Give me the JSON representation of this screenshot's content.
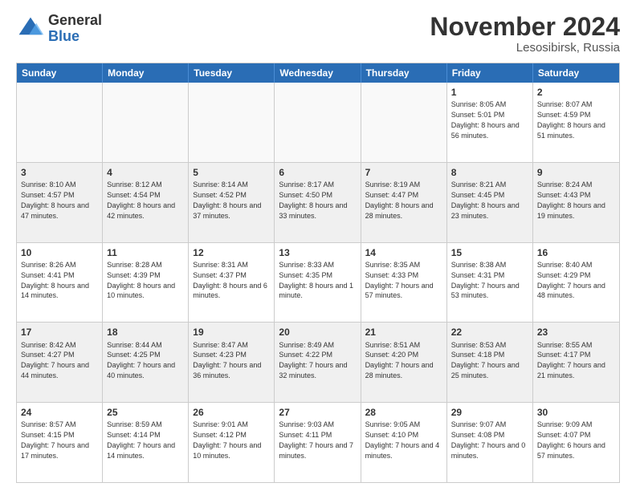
{
  "logo": {
    "general": "General",
    "blue": "Blue"
  },
  "header": {
    "month": "November 2024",
    "location": "Lesosibirsk, Russia"
  },
  "weekdays": [
    "Sunday",
    "Monday",
    "Tuesday",
    "Wednesday",
    "Thursday",
    "Friday",
    "Saturday"
  ],
  "rows": [
    [
      {
        "day": "",
        "info": "",
        "empty": true
      },
      {
        "day": "",
        "info": "",
        "empty": true
      },
      {
        "day": "",
        "info": "",
        "empty": true
      },
      {
        "day": "",
        "info": "",
        "empty": true
      },
      {
        "day": "",
        "info": "",
        "empty": true
      },
      {
        "day": "1",
        "info": "Sunrise: 8:05 AM\nSunset: 5:01 PM\nDaylight: 8 hours and 56 minutes.",
        "empty": false
      },
      {
        "day": "2",
        "info": "Sunrise: 8:07 AM\nSunset: 4:59 PM\nDaylight: 8 hours and 51 minutes.",
        "empty": false
      }
    ],
    [
      {
        "day": "3",
        "info": "Sunrise: 8:10 AM\nSunset: 4:57 PM\nDaylight: 8 hours and 47 minutes.",
        "empty": false
      },
      {
        "day": "4",
        "info": "Sunrise: 8:12 AM\nSunset: 4:54 PM\nDaylight: 8 hours and 42 minutes.",
        "empty": false
      },
      {
        "day": "5",
        "info": "Sunrise: 8:14 AM\nSunset: 4:52 PM\nDaylight: 8 hours and 37 minutes.",
        "empty": false
      },
      {
        "day": "6",
        "info": "Sunrise: 8:17 AM\nSunset: 4:50 PM\nDaylight: 8 hours and 33 minutes.",
        "empty": false
      },
      {
        "day": "7",
        "info": "Sunrise: 8:19 AM\nSunset: 4:47 PM\nDaylight: 8 hours and 28 minutes.",
        "empty": false
      },
      {
        "day": "8",
        "info": "Sunrise: 8:21 AM\nSunset: 4:45 PM\nDaylight: 8 hours and 23 minutes.",
        "empty": false
      },
      {
        "day": "9",
        "info": "Sunrise: 8:24 AM\nSunset: 4:43 PM\nDaylight: 8 hours and 19 minutes.",
        "empty": false
      }
    ],
    [
      {
        "day": "10",
        "info": "Sunrise: 8:26 AM\nSunset: 4:41 PM\nDaylight: 8 hours and 14 minutes.",
        "empty": false
      },
      {
        "day": "11",
        "info": "Sunrise: 8:28 AM\nSunset: 4:39 PM\nDaylight: 8 hours and 10 minutes.",
        "empty": false
      },
      {
        "day": "12",
        "info": "Sunrise: 8:31 AM\nSunset: 4:37 PM\nDaylight: 8 hours and 6 minutes.",
        "empty": false
      },
      {
        "day": "13",
        "info": "Sunrise: 8:33 AM\nSunset: 4:35 PM\nDaylight: 8 hours and 1 minute.",
        "empty": false
      },
      {
        "day": "14",
        "info": "Sunrise: 8:35 AM\nSunset: 4:33 PM\nDaylight: 7 hours and 57 minutes.",
        "empty": false
      },
      {
        "day": "15",
        "info": "Sunrise: 8:38 AM\nSunset: 4:31 PM\nDaylight: 7 hours and 53 minutes.",
        "empty": false
      },
      {
        "day": "16",
        "info": "Sunrise: 8:40 AM\nSunset: 4:29 PM\nDaylight: 7 hours and 48 minutes.",
        "empty": false
      }
    ],
    [
      {
        "day": "17",
        "info": "Sunrise: 8:42 AM\nSunset: 4:27 PM\nDaylight: 7 hours and 44 minutes.",
        "empty": false
      },
      {
        "day": "18",
        "info": "Sunrise: 8:44 AM\nSunset: 4:25 PM\nDaylight: 7 hours and 40 minutes.",
        "empty": false
      },
      {
        "day": "19",
        "info": "Sunrise: 8:47 AM\nSunset: 4:23 PM\nDaylight: 7 hours and 36 minutes.",
        "empty": false
      },
      {
        "day": "20",
        "info": "Sunrise: 8:49 AM\nSunset: 4:22 PM\nDaylight: 7 hours and 32 minutes.",
        "empty": false
      },
      {
        "day": "21",
        "info": "Sunrise: 8:51 AM\nSunset: 4:20 PM\nDaylight: 7 hours and 28 minutes.",
        "empty": false
      },
      {
        "day": "22",
        "info": "Sunrise: 8:53 AM\nSunset: 4:18 PM\nDaylight: 7 hours and 25 minutes.",
        "empty": false
      },
      {
        "day": "23",
        "info": "Sunrise: 8:55 AM\nSunset: 4:17 PM\nDaylight: 7 hours and 21 minutes.",
        "empty": false
      }
    ],
    [
      {
        "day": "24",
        "info": "Sunrise: 8:57 AM\nSunset: 4:15 PM\nDaylight: 7 hours and 17 minutes.",
        "empty": false
      },
      {
        "day": "25",
        "info": "Sunrise: 8:59 AM\nSunset: 4:14 PM\nDaylight: 7 hours and 14 minutes.",
        "empty": false
      },
      {
        "day": "26",
        "info": "Sunrise: 9:01 AM\nSunset: 4:12 PM\nDaylight: 7 hours and 10 minutes.",
        "empty": false
      },
      {
        "day": "27",
        "info": "Sunrise: 9:03 AM\nSunset: 4:11 PM\nDaylight: 7 hours and 7 minutes.",
        "empty": false
      },
      {
        "day": "28",
        "info": "Sunrise: 9:05 AM\nSunset: 4:10 PM\nDaylight: 7 hours and 4 minutes.",
        "empty": false
      },
      {
        "day": "29",
        "info": "Sunrise: 9:07 AM\nSunset: 4:08 PM\nDaylight: 7 hours and 0 minutes.",
        "empty": false
      },
      {
        "day": "30",
        "info": "Sunrise: 9:09 AM\nSunset: 4:07 PM\nDaylight: 6 hours and 57 minutes.",
        "empty": false
      }
    ]
  ]
}
